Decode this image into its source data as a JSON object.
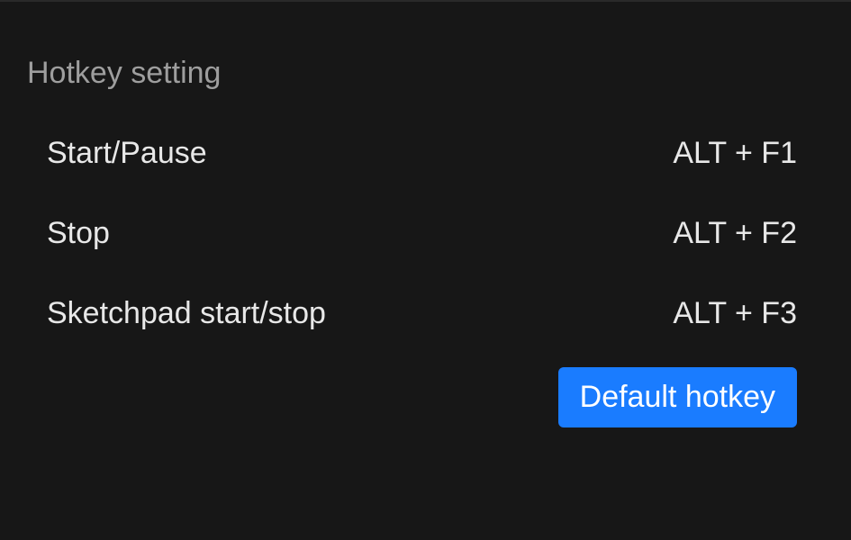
{
  "section": {
    "title": "Hotkey setting"
  },
  "hotkeys": [
    {
      "label": "Start/Pause",
      "value": "ALT + F1"
    },
    {
      "label": "Stop",
      "value": "ALT + F2"
    },
    {
      "label": "Sketchpad start/stop",
      "value": "ALT + F3"
    }
  ],
  "buttons": {
    "default_hotkey": "Default hotkey"
  }
}
